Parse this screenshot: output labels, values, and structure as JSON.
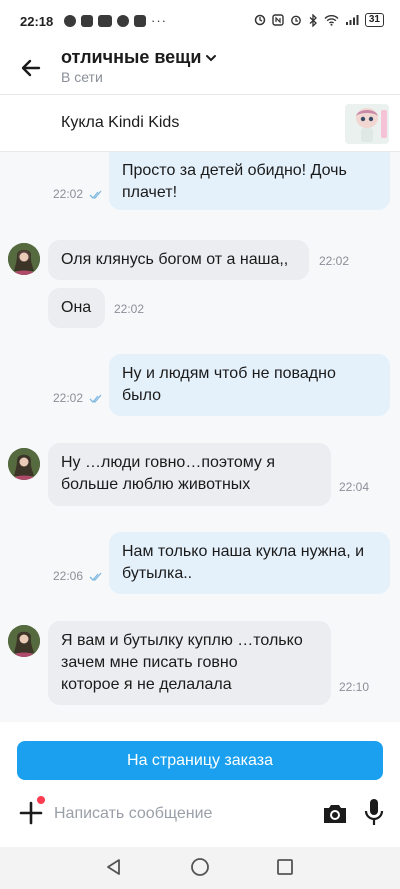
{
  "status_bar": {
    "time": "22:18",
    "battery": "31",
    "left_icons": [
      "chat-icon",
      "image-icon",
      "video-icon",
      "app-icon",
      "counter-icon"
    ],
    "right_icons": [
      "data-saver-icon",
      "nfc-icon",
      "alarm-icon",
      "bluetooth-icon",
      "wifi-icon",
      "signal-icon",
      "battery-icon"
    ]
  },
  "header": {
    "title": "отличные вещи",
    "subtitle": "В сети"
  },
  "product": {
    "title": "Кукла Kindi Kids"
  },
  "messages": [
    {
      "dir": "out",
      "text": "Просто за детей обидно! Дочь плачет!",
      "line1": "Просто за детей обидно! Дочь",
      "line2": "плачет!",
      "time": "22:02"
    },
    {
      "dir": "in",
      "text": "Оля клянусь богом от а наша,,",
      "time": "22:02"
    },
    {
      "dir": "in",
      "text": "Она",
      "time": "22:02"
    },
    {
      "dir": "out",
      "text": "Ну и людям чтоб не повадно было",
      "line1": "Ну и людям чтоб не повадно",
      "line2": "было",
      "time": "22:02"
    },
    {
      "dir": "in",
      "text": "Ну …люди говно…поэтому я больше люблю животных",
      "line1": "Ну …люди говно…поэтому я",
      "line2": "больше люблю животных",
      "time": "22:04"
    },
    {
      "dir": "out",
      "text": "Нам только наша кукла нужна, и бутылка..",
      "line1": "Нам только наша кукла нужна, и",
      "line2": "бутылка..",
      "time": "22:06"
    },
    {
      "dir": "in",
      "text": "Я вам и бутылку куплю …только зачем мне писать говно которое я не делалала",
      "line1": "Я вам и бутылку куплю …только",
      "line2": "зачем мне писать говно",
      "line3": "которое я не делалала",
      "time": "22:10"
    }
  ],
  "footer": {
    "order_button": "На страницу заказа",
    "input_placeholder": "Написать сообщение"
  },
  "colors": {
    "accent": "#1aa0ee",
    "outgoing_bubble": "#e4f1fb",
    "incoming_bubble": "#ecedf0",
    "read_ticks": "#7fb8e0",
    "notification_dot": "#ff3b50"
  }
}
